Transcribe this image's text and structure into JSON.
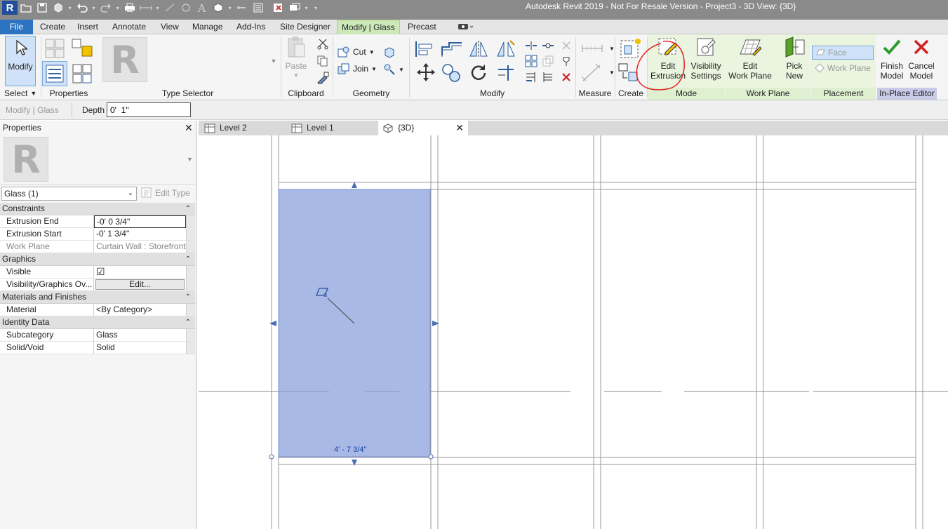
{
  "titlebar": {
    "title": "Autodesk Revit 2019 - Not For Resale Version - Project3 - 3D View: {3D}",
    "app_logo": "R",
    "quick_access": [
      "open-icon",
      "save-icon",
      "sync-icon",
      "undo-icon",
      "redo-icon",
      "print-icon",
      "measure-icon",
      "dimension-icon",
      "tag-icon",
      "text-icon",
      "3d-view-icon",
      "section-icon",
      "thin-lines-icon",
      "close-hidden-icon",
      "switch-windows-icon",
      "customize-icon"
    ]
  },
  "ribbon_tabs": [
    "File",
    "Create",
    "Insert",
    "Annotate",
    "View",
    "Manage",
    "Add-Ins",
    "Site Designer",
    "Modify | Glass",
    "Precast"
  ],
  "ribbon": {
    "modify_label": "Modify",
    "select_label": "Select",
    "properties_label": "Properties",
    "type_selector_label": "Type Selector",
    "type_preview_letter": "R",
    "paste_label": "Paste",
    "clipboard_label": "Clipboard",
    "cut_label": "Cut",
    "join_label": "Join",
    "geometry_label": "Geometry",
    "modify_panel_label": "Modify",
    "measure_label": "Measure",
    "create_label": "Create",
    "edit_extrusion_line1": "Edit",
    "edit_extrusion_line2": "Extrusion",
    "mode_label": "Mode",
    "visibility_line1": "Visibility",
    "visibility_line2": "Settings",
    "edit_work_plane_line1": "Edit",
    "edit_work_plane_line2": "Work Plane",
    "work_plane_panel_label": "Work Plane",
    "pick_new_line1": "Pick",
    "pick_new_line2": "New",
    "face_label": "Face",
    "work_plane_option": "Work Plane",
    "placement_label": "Placement",
    "finish_model_line1": "Finish",
    "finish_model_line2": "Model",
    "cancel_model_line1": "Cancel",
    "cancel_model_line2": "Model",
    "in_place_editor_label": "In-Place Editor"
  },
  "options_bar": {
    "context": "Modify | Glass",
    "depth_label": "Depth",
    "depth_value": "0'  1\""
  },
  "properties": {
    "title": "Properties",
    "preview_letter": "R",
    "type_dropdown": "Glass (1)",
    "edit_type": "Edit Type",
    "groups": {
      "constraints": "Constraints",
      "graphics": "Graphics",
      "materials": "Materials and Finishes",
      "identity": "Identity Data"
    },
    "rows": {
      "extrusion_end": {
        "key": "Extrusion End",
        "value": "-0'  0 3/4\""
      },
      "extrusion_start": {
        "key": "Extrusion Start",
        "value": "-0'  1 3/4\""
      },
      "work_plane": {
        "key": "Work Plane",
        "value": "Curtain Wall : Storefront"
      },
      "visible": {
        "key": "Visible",
        "value": "☑"
      },
      "vis_graphics": {
        "key": "Visibility/Graphics Ov...",
        "value": "Edit..."
      },
      "material": {
        "key": "Material",
        "value": "<By Category>"
      },
      "subcategory": {
        "key": "Subcategory",
        "value": "Glass"
      },
      "solid_void": {
        "key": "Solid/Void",
        "value": "Solid"
      }
    }
  },
  "view_tabs": [
    "Level 2",
    "Level 1",
    "{3D}"
  ],
  "canvas": {
    "dimension_text": "4' - 7 3/4\"",
    "glass_color": "#a8b9e6",
    "annotation_color": "#e02020"
  }
}
